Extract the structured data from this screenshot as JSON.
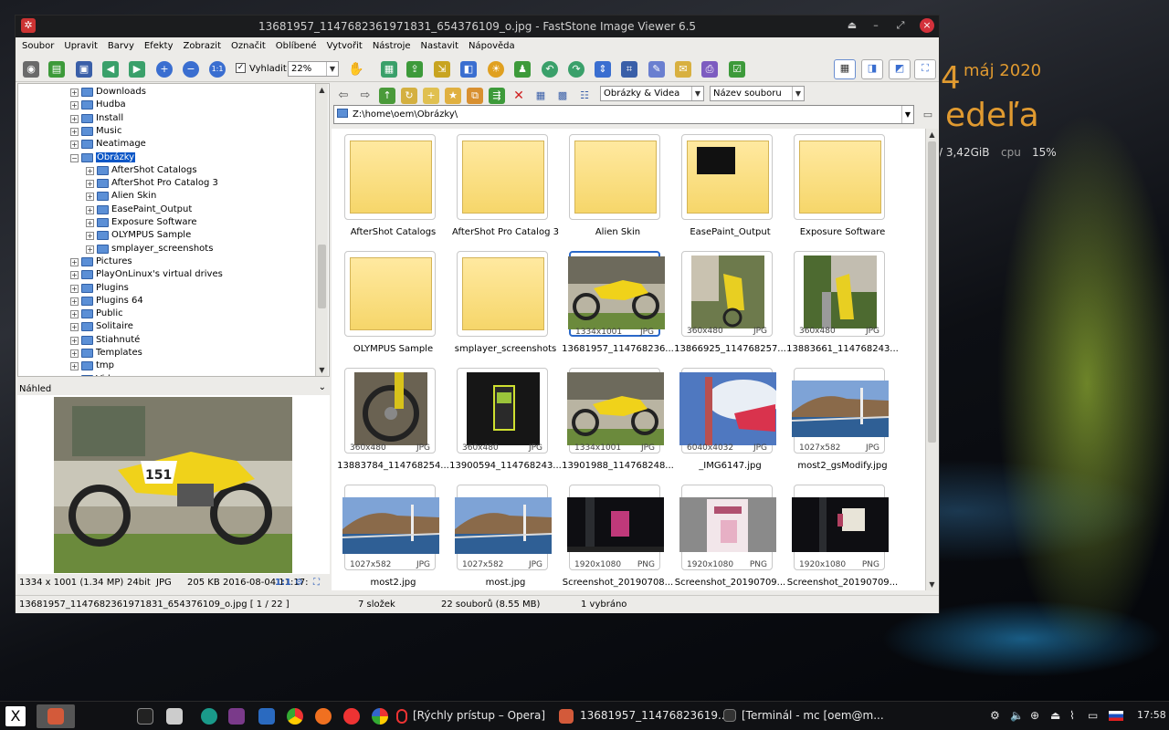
{
  "desktop": {
    "date_fragment": "4",
    "month_year": "máj 2020",
    "day_fragment": "edeľa",
    "mem": "/ 3,42GiB",
    "cpu_label": "cpu",
    "cpu_value": "15%"
  },
  "window": {
    "title": "13681957_1147682361971831_654376109_o.jpg - FastStone Image Viewer 6.5"
  },
  "menu": [
    "Soubor",
    "Upravit",
    "Barvy",
    "Efekty",
    "Zobrazit",
    "Označit",
    "Oblíbené",
    "Vytvořit",
    "Nástroje",
    "Nastavit",
    "Nápověda"
  ],
  "toolbar": {
    "fit_label": "Vyhladit",
    "zoom": "22%"
  },
  "nav": {
    "filter": "Obrázky & Videa",
    "sort": "Název souboru"
  },
  "path": "Z:\\home\\oem\\Obrázky\\",
  "tree": [
    {
      "label": "Downloads",
      "level": 0
    },
    {
      "label": "Hudba",
      "level": 0
    },
    {
      "label": "Install",
      "level": 0
    },
    {
      "label": "Music",
      "level": 0
    },
    {
      "label": "Neatimage",
      "level": 0
    },
    {
      "label": "Obrázky",
      "level": 0
    },
    {
      "label": "AfterShot Catalogs",
      "level": 1
    },
    {
      "label": "AfterShot Pro Catalog 3",
      "level": 1
    },
    {
      "label": "Alien Skin",
      "level": 1
    },
    {
      "label": "EasePaint_Output",
      "level": 1
    },
    {
      "label": "Exposure Software",
      "level": 1
    },
    {
      "label": "OLYMPUS Sample",
      "level": 1
    },
    {
      "label": "smplayer_screenshots",
      "level": 1
    },
    {
      "label": "Pictures",
      "level": 0
    },
    {
      "label": "PlayOnLinux's virtual drives",
      "level": 0
    },
    {
      "label": "Plugins",
      "level": 0
    },
    {
      "label": "Plugins 64",
      "level": 0
    },
    {
      "label": "Public",
      "level": 0
    },
    {
      "label": "Solitaire",
      "level": 0
    },
    {
      "label": "Stiahnuté",
      "level": 0
    },
    {
      "label": "Templates",
      "level": 0
    },
    {
      "label": "tmp",
      "level": 0
    },
    {
      "label": "Video",
      "level": 0
    }
  ],
  "preview": {
    "title": "Náhled",
    "res": "1334 x 1001 (1.34 MP)",
    "bits": "24bit",
    "fmt": "JPG",
    "size": "205 KB",
    "date": "2016-08-04 11:17:",
    "ratio": "1:1"
  },
  "thumbnails": [
    {
      "name": "AfterShot Catalogs",
      "type": "folder"
    },
    {
      "name": "AfterShot Pro Catalog 3",
      "type": "folder"
    },
    {
      "name": "Alien Skin",
      "type": "folder"
    },
    {
      "name": "EasePaint_Output",
      "type": "folder"
    },
    {
      "name": "Exposure Software",
      "type": "folder"
    },
    {
      "name": "OLYMPUS Sample",
      "type": "folder"
    },
    {
      "name": "smplayer_screenshots",
      "type": "folder"
    },
    {
      "name": "13681957_114768236...",
      "dim": "1334x1001",
      "fmt": "JPG",
      "type": "bike",
      "selected": true
    },
    {
      "name": "13866925_114768257...",
      "dim": "360x480",
      "fmt": "JPG",
      "type": "bike2"
    },
    {
      "name": "13883661_114768243...",
      "dim": "360x480",
      "fmt": "JPG",
      "type": "bike3"
    },
    {
      "name": "13883784_114768254...",
      "dim": "360x480",
      "fmt": "JPG",
      "type": "wheel"
    },
    {
      "name": "13900594_114768243...",
      "dim": "360x480",
      "fmt": "JPG",
      "type": "dark"
    },
    {
      "name": "13901988_114768248...",
      "dim": "1334x1001",
      "fmt": "JPG",
      "type": "bike"
    },
    {
      "name": "_IMG6147.jpg",
      "dim": "6040x4032",
      "fmt": "JPG",
      "type": "sky"
    },
    {
      "name": "most2_gsModify.jpg",
      "dim": "1027x582",
      "fmt": "JPG",
      "type": "bridge"
    },
    {
      "name": "most2.jpg",
      "dim": "1027x582",
      "fmt": "JPG",
      "type": "bridge"
    },
    {
      "name": "most.jpg",
      "dim": "1027x582",
      "fmt": "JPG",
      "type": "bridge"
    },
    {
      "name": "Screenshot_20190708...",
      "dim": "1920x1080",
      "fmt": "PNG",
      "type": "shot1"
    },
    {
      "name": "Screenshot_20190709...",
      "dim": "1920x1080",
      "fmt": "PNG",
      "type": "shot2"
    },
    {
      "name": "Screenshot_20190709...",
      "dim": "1920x1080",
      "fmt": "PNG",
      "type": "shot3"
    }
  ],
  "status": {
    "file": "13681957_1147682361971831_654376109_o.jpg [ 1 / 22 ]",
    "folders": "7 složek",
    "files": "22 souborů (8.55 MB)",
    "selected": "1 vybráno"
  },
  "taskbar": {
    "opera": "[Rýchly prístup – Opera]",
    "viewer": "13681957_11476823619...",
    "terminal": "[Terminál - mc [oem@m...",
    "clock": "17:58"
  }
}
